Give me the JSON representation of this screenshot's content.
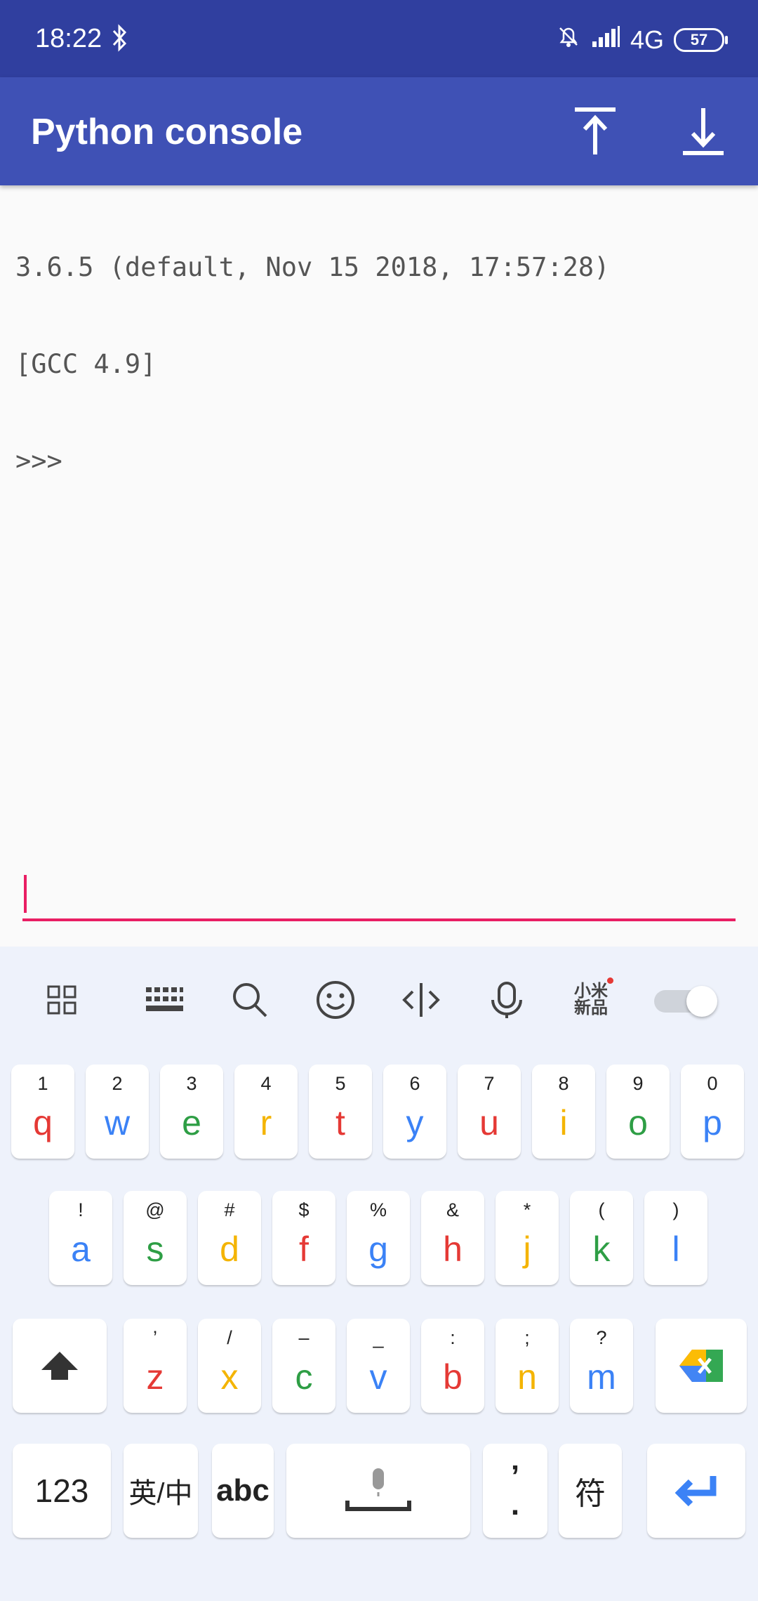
{
  "status": {
    "time": "18:22",
    "network": "4G",
    "battery": "57"
  },
  "appbar": {
    "title": "Python console"
  },
  "console": {
    "lines": [
      "3.6.5 (default, Nov 15 2018, 17:57:28)",
      "[GCC 4.9]",
      ">>>"
    ]
  },
  "input": {
    "value": ""
  },
  "keyboard": {
    "toolbar": {
      "brand": "小米\n新品"
    },
    "row1": [
      {
        "sub": "1",
        "main": "q",
        "color": "#e53935"
      },
      {
        "sub": "2",
        "main": "w",
        "color": "#3b82f6"
      },
      {
        "sub": "3",
        "main": "e",
        "color": "#2e9e45"
      },
      {
        "sub": "4",
        "main": "r",
        "color": "#f4b400"
      },
      {
        "sub": "5",
        "main": "t",
        "color": "#e53935"
      },
      {
        "sub": "6",
        "main": "y",
        "color": "#3b82f6"
      },
      {
        "sub": "7",
        "main": "u",
        "color": "#e53935"
      },
      {
        "sub": "8",
        "main": "i",
        "color": "#f4b400"
      },
      {
        "sub": "9",
        "main": "o",
        "color": "#2e9e45"
      },
      {
        "sub": "0",
        "main": "p",
        "color": "#3b82f6"
      }
    ],
    "row2": [
      {
        "sub": "!",
        "main": "a",
        "color": "#3b82f6"
      },
      {
        "sub": "@",
        "main": "s",
        "color": "#2e9e45"
      },
      {
        "sub": "#",
        "main": "d",
        "color": "#f4b400"
      },
      {
        "sub": "$",
        "main": "f",
        "color": "#e53935"
      },
      {
        "sub": "%",
        "main": "g",
        "color": "#3b82f6"
      },
      {
        "sub": "&",
        "main": "h",
        "color": "#e53935"
      },
      {
        "sub": "*",
        "main": "j",
        "color": "#f4b400"
      },
      {
        "sub": "(",
        "main": "k",
        "color": "#2e9e45"
      },
      {
        "sub": ")",
        "main": "l",
        "color": "#3b82f6"
      }
    ],
    "row3": [
      {
        "sub": "’",
        "main": "z",
        "color": "#e53935"
      },
      {
        "sub": "/",
        "main": "x",
        "color": "#f4b400"
      },
      {
        "sub": "–",
        "main": "c",
        "color": "#2e9e45"
      },
      {
        "sub": "_",
        "main": "v",
        "color": "#3b82f6"
      },
      {
        "sub": ":",
        "main": "b",
        "color": "#e53935"
      },
      {
        "sub": ";",
        "main": "n",
        "color": "#f4b400"
      },
      {
        "sub": "?",
        "main": "m",
        "color": "#3b82f6"
      }
    ],
    "row4": {
      "num": "123",
      "lang": "英/中",
      "abc": "abc",
      "punct": "’\n.",
      "symbols": "符"
    }
  },
  "colors": {
    "statusbar": "#303f9f",
    "appbar": "#3f51b5",
    "accent": "#e91e63",
    "enter": "#3b82f6"
  }
}
